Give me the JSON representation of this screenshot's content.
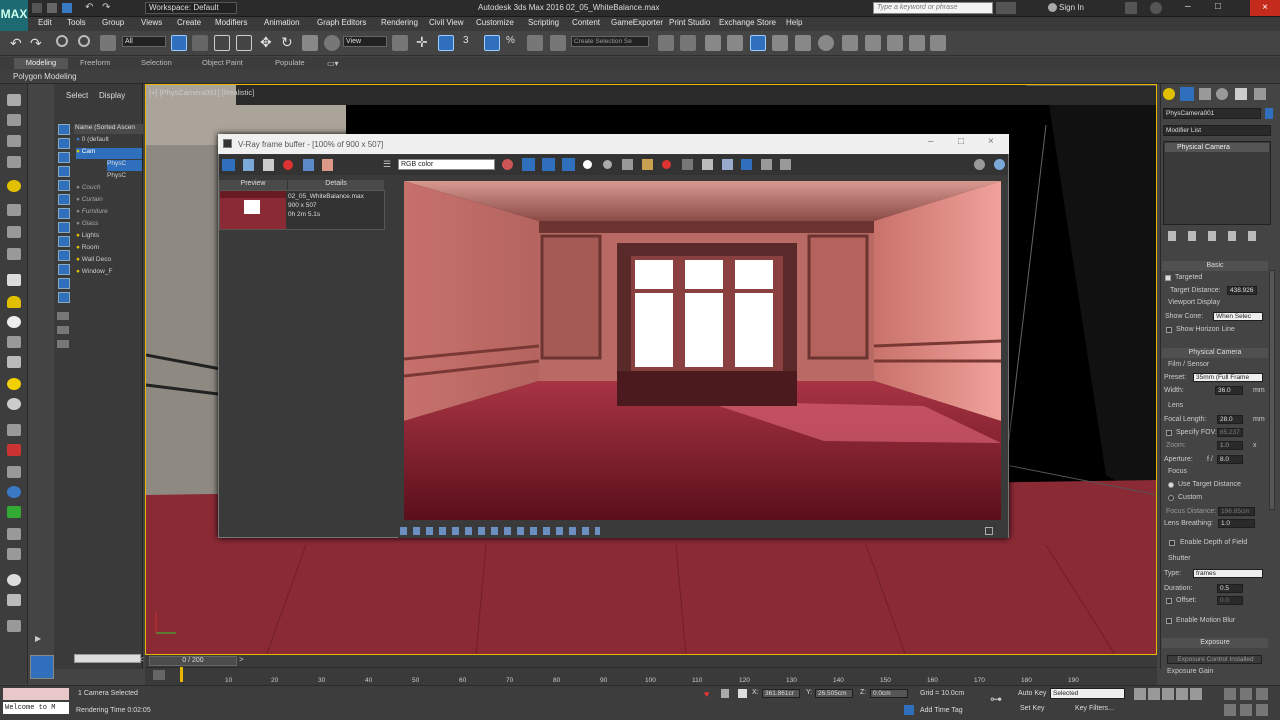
{
  "window": {
    "title": "Autodesk 3ds Max 2016    02_05_WhiteBalance.max",
    "workspace_label": "Workspace: Default",
    "search_placeholder": "Type a keyword or phrase",
    "sign_in": "Sign In"
  },
  "app_logo": "MAX",
  "menu": [
    "Edit",
    "Tools",
    "Group",
    "Views",
    "Create",
    "Modifiers",
    "Animation",
    "Graph Editors",
    "Rendering",
    "Civil View",
    "Customize",
    "Scripting",
    "Content",
    "GameExporter",
    "Print Studio",
    "Exchange Store",
    "Help"
  ],
  "toolbar": {
    "selection_filter": "All",
    "reference_coord": "View",
    "named_selection": "Create Selection Se"
  },
  "ribbon": {
    "tabs": [
      "Modeling",
      "Freeform",
      "Selection",
      "Object Paint",
      "Populate"
    ],
    "sub_label": "Polygon Modeling"
  },
  "scene_explorer": {
    "tabs": [
      "Select",
      "Display"
    ],
    "header": "Name (Sorted Ascen",
    "rows": [
      "0 (default",
      "Cam",
      "PhysC",
      "PhysC",
      "Couch",
      "Curtain",
      "Furniture",
      "Glass",
      "Lights",
      "Room",
      "Wall Deco",
      "Window_F"
    ]
  },
  "viewport": {
    "label": "[+] [PhysCamera001] [Realistic]"
  },
  "vfb": {
    "title": "V-Ray frame buffer - [100% of 900 x 507]",
    "channel": "RGB color",
    "history_tabs": [
      "Preview",
      "Details"
    ],
    "history_item": {
      "file": "02_05_WhiteBalance.max",
      "size": "900 x 507",
      "time": "0h 2m 5.1s"
    }
  },
  "command_panel": {
    "object_name": "PhysCamera001",
    "modifier_list": "Modifier List",
    "stack_item": "Physical Camera",
    "basic": {
      "rollout": "Basic",
      "targeted": "Targeted",
      "target_distance_label": "Target Distance:",
      "target_distance": "438.926",
      "viewport_display": "Viewport Display",
      "show_cone_label": "Show Cone:",
      "show_cone": "When Selec",
      "show_horizon": "Show Horizon Line"
    },
    "physical_camera": {
      "rollout": "Physical Camera",
      "film_sensor": "Film / Sensor",
      "preset_label": "Preset:",
      "preset": "35mm (Full Frame",
      "width_label": "Width:",
      "width": "36.0",
      "width_unit": "mm",
      "lens": "Lens",
      "focal_length_label": "Focal Length:",
      "focal_length": "28.0",
      "focal_unit": "mm",
      "specify_fov": "Specify FOV:",
      "fov": "65.237",
      "zoom_label": "Zoom:",
      "zoom": "1.0",
      "zoom_unit": "x",
      "aperture_label": "Aperture:",
      "aperture_prefix": "f /",
      "aperture": "8.0",
      "focus": "Focus",
      "use_target": "Use Target Distance",
      "custom": "Custom",
      "focus_distance_label": "Focus Distance:",
      "focus_distance": "196.85cm",
      "lens_breathing_label": "Lens Breathing:",
      "lens_breathing": "1.0",
      "enable_dof": "Enable Depth of Field",
      "shutter": "Shutter",
      "type_label": "Type:",
      "type": "frames",
      "duration_label": "Duration:",
      "duration": "0.5",
      "offset_label": "Offset:",
      "offset": "0.0",
      "enable_motion_blur": "Enable Motion Blur"
    },
    "exposure": {
      "rollout": "Exposure",
      "control_installed": "Exposure Control Installed",
      "gain": "Exposure Gain"
    }
  },
  "timeline": {
    "frame": "0 / 200",
    "ticks": [
      "10",
      "20",
      "30",
      "40",
      "50",
      "60",
      "70",
      "80",
      "90",
      "100",
      "110",
      "120",
      "130",
      "140",
      "150",
      "160",
      "170",
      "180",
      "190"
    ],
    "current_fraction": 0
  },
  "status": {
    "maxscript": "Welcome to M",
    "selected": "1 Camera Selected",
    "render_time": "Rendering Time  0:02:05",
    "x": "361.861cr",
    "y": "26.505cm",
    "z": "0.0cm",
    "grid": "Grid = 10.0cm",
    "add_time_tag": "Add Time Tag",
    "auto_key": "Auto Key",
    "auto_key_value": "Selected",
    "set_key": "Set Key",
    "key_filters": "Key Filters..."
  },
  "colors": {
    "accent_blue": "#2f6fbc",
    "viewport_border": "#e8b800",
    "floor": "#8a2a35",
    "wall": "#d7857e"
  }
}
